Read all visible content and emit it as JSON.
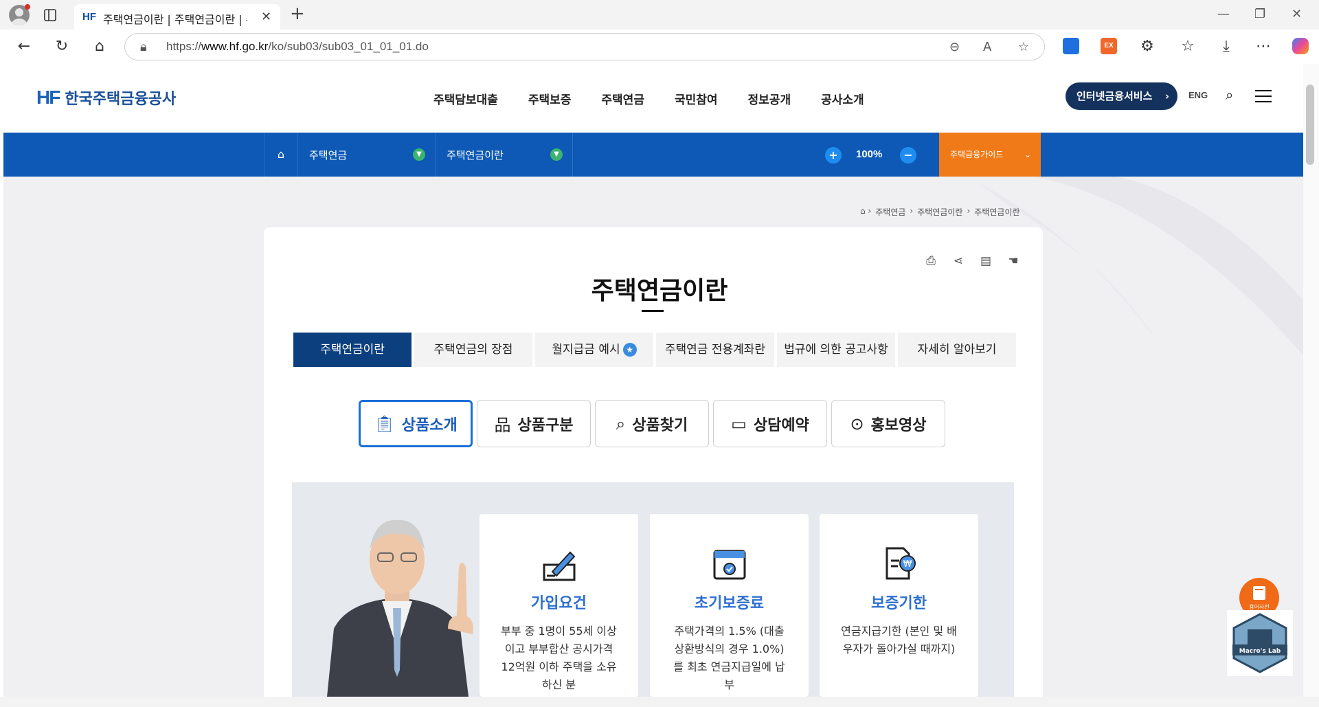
{
  "browser": {
    "tab_title": "주택연금이란 | 주택연금이란 | 주",
    "tab_favicon": "HF",
    "url_prefix": "https://",
    "url_host": "www.hf.go.kr",
    "url_path": "/ko/sub03/sub03_01_01_01.do",
    "ext_label": "EX"
  },
  "site": {
    "logo_mark": "HF",
    "logo_text": "한국주택금융공사",
    "gnb": [
      "주택담보대출",
      "주택보증",
      "주택연금",
      "국민참여",
      "정보공개",
      "공사소개"
    ],
    "internet_service": "인터넷금융서비스",
    "eng": "ENG"
  },
  "subnav": {
    "depth1": "주택연금",
    "depth2": "주택연금이란",
    "zoom": "100%",
    "guide": "주택금융가이드"
  },
  "breadcrumb": [
    "주택연금",
    "주택연금이란",
    "주택연금이란"
  ],
  "page": {
    "title": "주택연금이란",
    "tabs": [
      "주택연금이란",
      "주택연금의 장점",
      "월지급금 예시",
      "주택연금 전용계좌란",
      "법규에 의한 공고사항",
      "자세히 알아보기"
    ],
    "segments": [
      "상품소개",
      "상품구분",
      "상품찾기",
      "상담예약",
      "홍보영상"
    ],
    "cards": [
      {
        "title": "가입요건",
        "text": "부부 중 1명이 55세 이상이고 부부합산 공시가격 12억원 이하 주택을 소유하신 분"
      },
      {
        "title": "초기보증료",
        "text": "주택가격의 1.5% (대출상환방식의 경우 1.0%)를 최초 연금지급일에 납부"
      },
      {
        "title": "보증기한",
        "text": "연금지급기한 (본인 및 배우자가 돌아가실 때까지)"
      }
    ]
  },
  "floating": {
    "dictionary": "용어사전",
    "macro": "Macro's Lab"
  },
  "colors": {
    "brand_blue": "#0d59b5",
    "navy": "#14325d",
    "tab_active": "#0c3f7d",
    "orange": "#f07a17",
    "card_title": "#2d6fd0"
  }
}
